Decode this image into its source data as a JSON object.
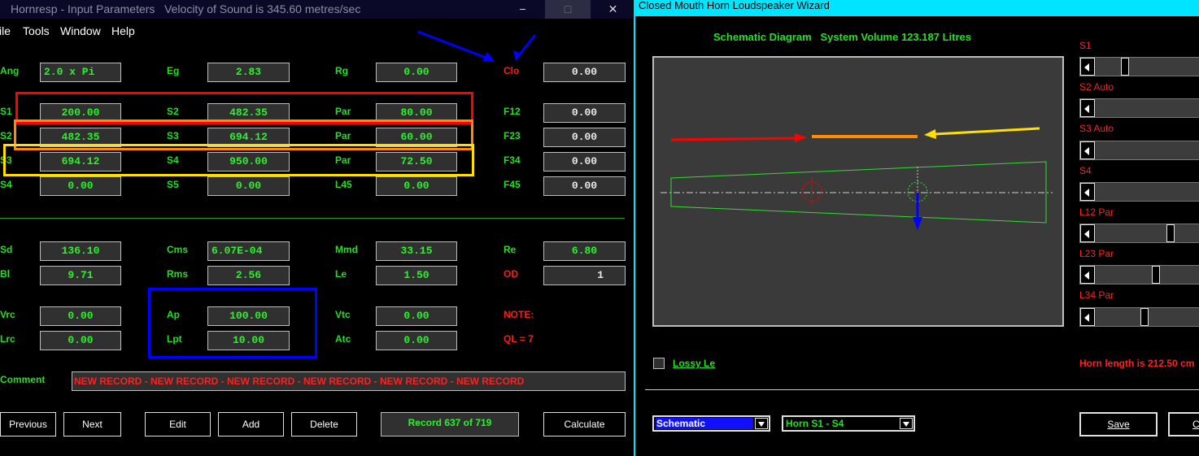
{
  "left": {
    "title": "Hornresp - Input Parameters   Velocity of Sound is 345.60 metres/sec",
    "window_buttons": {
      "min": "−",
      "max": "□",
      "close": "✕"
    },
    "menu": [
      "ile",
      "Tools",
      "Window",
      "Help"
    ],
    "rows": [
      {
        "l1": "Ang",
        "v1": "2.0 x Pi",
        "l2": "Eg",
        "v2": "2.83",
        "l3": "Rg",
        "v3": "0.00",
        "l4": "Clo",
        "v4": "0.00"
      },
      {
        "l1": "S1",
        "v1": "200.00",
        "l2": "S2",
        "v2": "482.35",
        "l3": "Par",
        "v3": "80.00",
        "l4": "F12",
        "v4": "0.00"
      },
      {
        "l1": "S2",
        "v1": "482.35",
        "l2": "S3",
        "v2": "694.12",
        "l3": "Par",
        "v3": "60.00",
        "l4": "F23",
        "v4": "0.00"
      },
      {
        "l1": "S3",
        "v1": "694.12",
        "l2": "S4",
        "v2": "950.00",
        "l3": "Par",
        "v3": "72.50",
        "l4": "F34",
        "v4": "0.00"
      },
      {
        "l1": "S4",
        "v1": "0.00",
        "l2": "S5",
        "v2": "0.00",
        "l3": "L45",
        "v3": "0.00",
        "l4": "F45",
        "v4": "0.00"
      }
    ],
    "driver": [
      {
        "l1": "Sd",
        "v1": "136.10",
        "l2": "Cms",
        "v2": "6.07E-04",
        "l3": "Mmd",
        "v3": "33.15",
        "l4": "Re",
        "v4": "6.80"
      },
      {
        "l1": "Bl",
        "v1": "9.71",
        "l2": "Rms",
        "v2": "2.56",
        "l3": "Le",
        "v3": "1.50",
        "l4": "OD",
        "v4": "1"
      }
    ],
    "chamber": [
      {
        "l1": "Vrc",
        "v1": "0.00",
        "l2": "Ap",
        "v2": "100.00",
        "l3": "Vtc",
        "v3": "0.00",
        "note": "NOTE:"
      },
      {
        "l1": "Lrc",
        "v1": "0.00",
        "l2": "Lpt",
        "v2": "10.00",
        "l3": "Atc",
        "v3": "0.00",
        "note": "QL = 7"
      }
    ],
    "comment_label": "Comment",
    "comment": "NEW RECORD - NEW RECORD - NEW RECORD - NEW RECORD - NEW RECORD - NEW RECORD",
    "buttons": {
      "previous": "Previous",
      "next": "Next",
      "edit": "Edit",
      "add": "Add",
      "delete": "Delete",
      "calculate": "Calculate"
    },
    "record": "Record 637 of 719",
    "colors": {
      "green": "#22e022",
      "red": "#ff1a1a",
      "annot_red": "#ff0000",
      "annot_orange": "#ff8c00",
      "annot_yellow": "#ffe000",
      "annot_blue": "#0000ff"
    }
  },
  "right": {
    "title": "Closed Mouth Horn Loudspeaker Wizard",
    "schematic_title": "Schematic Diagram   System Volume 123.187 Litres",
    "sliders": [
      {
        "label": "S1",
        "level": 0.35
      },
      {
        "label": "S2 Auto",
        "level": null
      },
      {
        "label": "S3 Auto",
        "level": null
      },
      {
        "label": "S4",
        "level": null
      },
      {
        "label": "L12  Par",
        "level": 0.75
      },
      {
        "label": "L23  Par",
        "level": 0.62
      },
      {
        "label": "L34  Par",
        "level": 0.53
      }
    ],
    "lossy_label": "Lossy Le",
    "horn_length": "Horn length is 212.50 cm",
    "view_select": "Schematic",
    "horn_select": "Horn S1 - S4",
    "save": "Save",
    "cancel": "Ca"
  }
}
